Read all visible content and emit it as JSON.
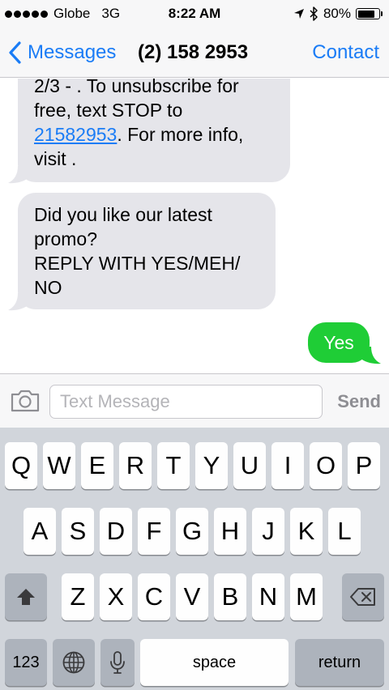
{
  "status_bar": {
    "carrier": "Globe",
    "network": "3G",
    "time": "8:22 AM",
    "battery_percent": "80%",
    "battery_level": 0.8,
    "icons": [
      "signal-dots-icon",
      "location-arrow-icon",
      "bluetooth-icon",
      "battery-icon"
    ]
  },
  "nav": {
    "back_label": "Messages",
    "title": "(2) 158 2953",
    "contact_label": "Contact",
    "accent_color": "#1a7cf6"
  },
  "conversation": {
    "messages": [
      {
        "direction": "incoming",
        "lines": [
          "2/3 - . To unsubscribe for",
          "free, text STOP to"
        ],
        "link": "21582953",
        "link_suffix": ". For more info,",
        "last_line": "visit ."
      },
      {
        "direction": "incoming",
        "lines": [
          "Did you like our latest",
          "promo?",
          "REPLY WITH YES/MEH/",
          "NO"
        ]
      },
      {
        "direction": "outgoing",
        "text": "Yes",
        "color": "#1fcd36"
      }
    ]
  },
  "input_bar": {
    "placeholder": "Text Message",
    "send_label": "Send"
  },
  "keyboard": {
    "row1": [
      "Q",
      "W",
      "E",
      "R",
      "T",
      "Y",
      "U",
      "I",
      "O",
      "P"
    ],
    "row2": [
      "A",
      "S",
      "D",
      "F",
      "G",
      "H",
      "J",
      "K",
      "L"
    ],
    "row3": [
      "Z",
      "X",
      "C",
      "V",
      "B",
      "N",
      "M"
    ],
    "numbers_label": "123",
    "space_label": "space",
    "return_label": "return"
  }
}
